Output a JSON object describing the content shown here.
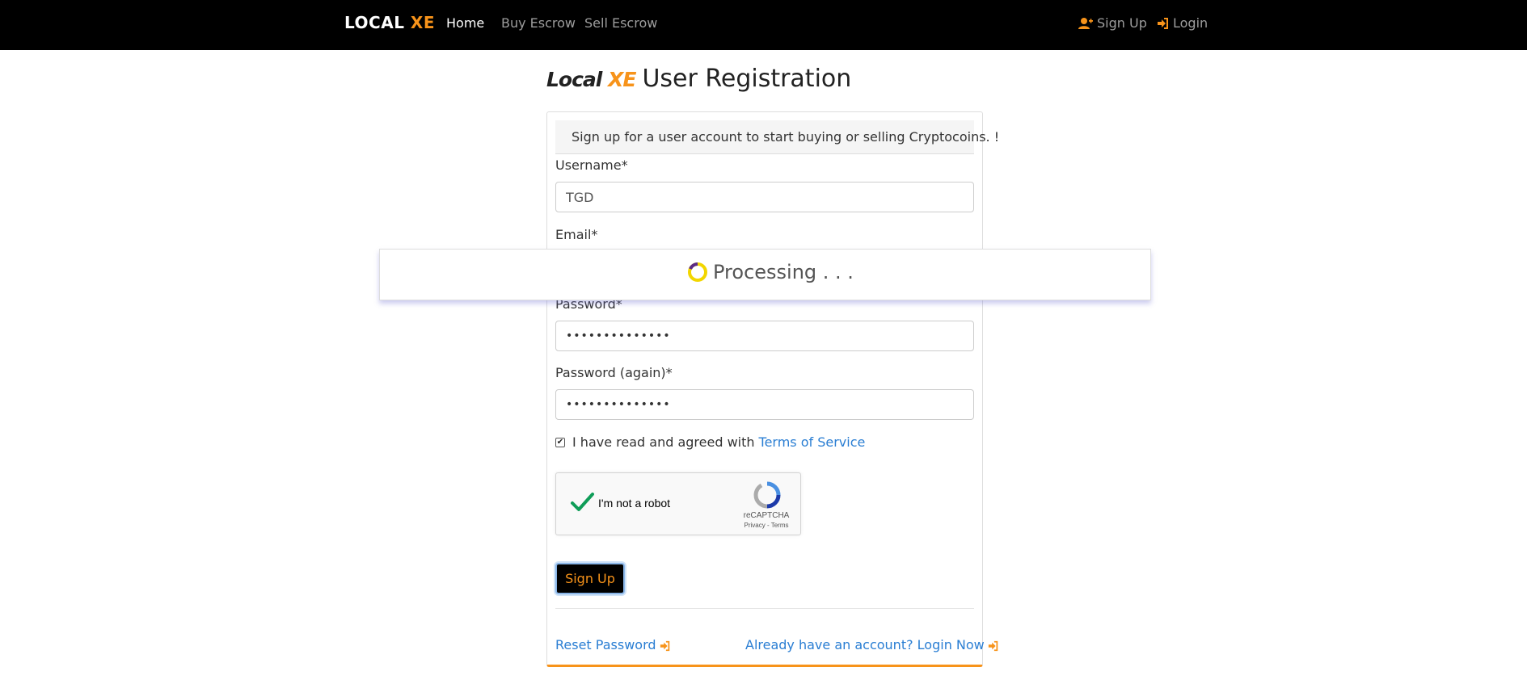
{
  "navbar": {
    "brand_main": "LOCAL ",
    "brand_accent": "XE",
    "links": [
      {
        "label": "Home",
        "active": true
      },
      {
        "label": "Buy Escrow",
        "active": false
      },
      {
        "label": "Sell Escrow",
        "active": false
      }
    ],
    "signup_label": "Sign Up",
    "login_label": "Login",
    "signup_icon": "user-plus-icon",
    "login_icon": "sign-in-icon"
  },
  "heading": {
    "logo_main": "Local",
    "logo_accent": "XE",
    "title": "User Registration"
  },
  "form": {
    "intro": "Sign up for a user account to start buying or selling Cryptocoins. !",
    "username_label": "Username*",
    "username_value": "TGD",
    "email_label": "Email*",
    "password_label": "Password*",
    "password_value": "••••••••••••••",
    "password_again_label": "Password (again)*",
    "password_again_value": "••••••••••••••",
    "terms_checked": true,
    "terms_text": "I have read and agreed with",
    "terms_link": "Terms of Service",
    "recaptcha": {
      "label": "I'm not a robot",
      "brand": "reCAPTCHA",
      "sub": "Privacy - Terms",
      "checked": true
    },
    "submit_label": "Sign Up",
    "reset_link": "Reset Password",
    "login_link": "Already have an account? Login Now"
  },
  "overlay": {
    "text": "Processing . . ."
  },
  "colors": {
    "accent": "#f7931a",
    "link": "#2a7ed3",
    "navbar_bg": "#000000"
  }
}
